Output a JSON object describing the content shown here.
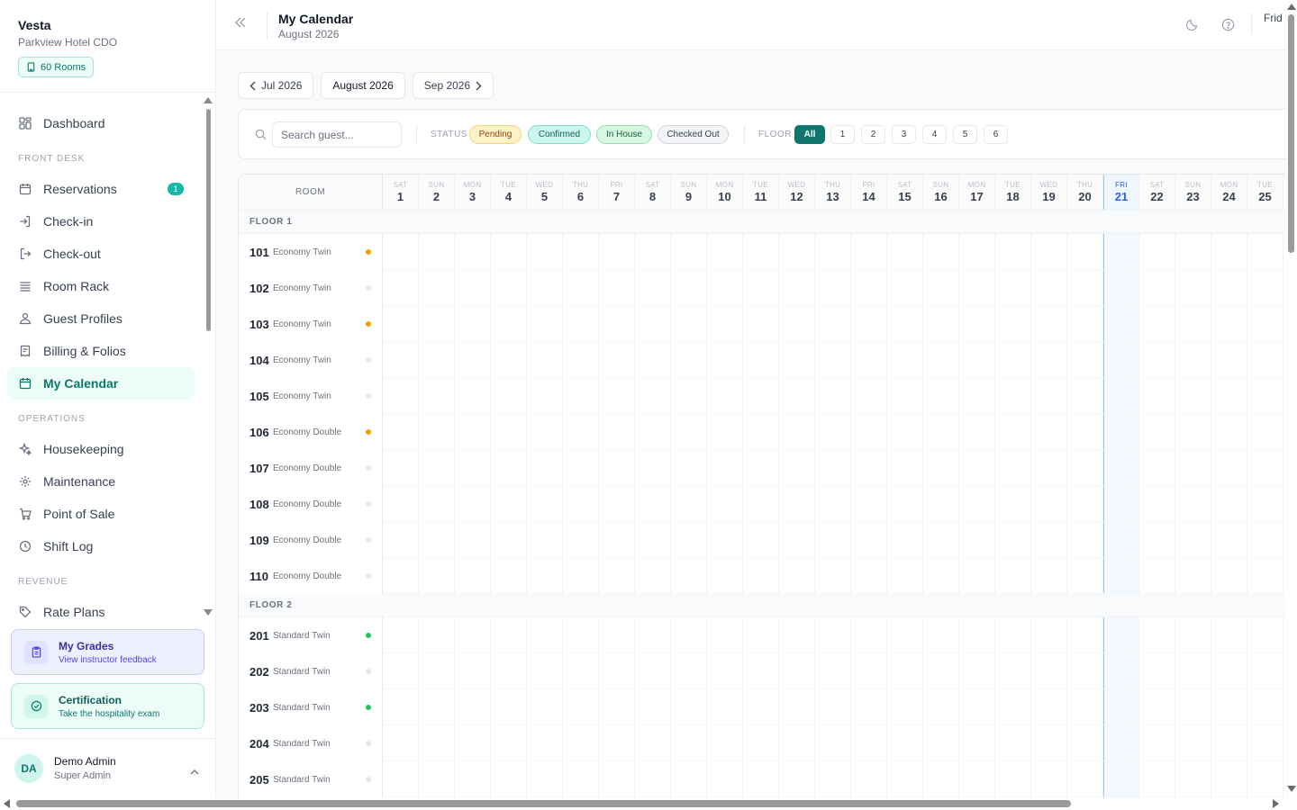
{
  "brand": {
    "name": "Vesta",
    "property": "Parkview Hotel CDO",
    "rooms_badge": "60 Rooms"
  },
  "nav": {
    "dashboard": "Dashboard",
    "sections": {
      "front_desk": "FRONT DESK",
      "operations": "OPERATIONS",
      "revenue": "REVENUE"
    },
    "front_desk": [
      {
        "label": "Reservations",
        "icon": "calendar-icon",
        "badge": "1"
      },
      {
        "label": "Check-in",
        "icon": "login-icon"
      },
      {
        "label": "Check-out",
        "icon": "logout-icon"
      },
      {
        "label": "Room Rack",
        "icon": "list-icon"
      },
      {
        "label": "Guest Profiles",
        "icon": "users-icon"
      },
      {
        "label": "Billing & Folios",
        "icon": "receipt-icon"
      },
      {
        "label": "My Calendar",
        "icon": "calendar-icon",
        "active": true
      }
    ],
    "operations": [
      {
        "label": "Housekeeping",
        "icon": "sparkle-icon"
      },
      {
        "label": "Maintenance",
        "icon": "gear-icon"
      },
      {
        "label": "Point of Sale",
        "icon": "cart-icon"
      },
      {
        "label": "Shift Log",
        "icon": "clock-icon"
      }
    ],
    "revenue": [
      {
        "label": "Rate Plans",
        "icon": "tag-icon"
      }
    ]
  },
  "promos": {
    "grades": {
      "title": "My Grades",
      "subtitle": "View instructor feedback"
    },
    "certification": {
      "title": "Certification",
      "subtitle": "Take the hospitality exam"
    }
  },
  "user": {
    "initials": "DA",
    "name": "Demo Admin",
    "role": "Super Admin"
  },
  "header": {
    "title": "My Calendar",
    "subtitle": "August 2026",
    "day_label": "Frid"
  },
  "month_nav": {
    "prev": "Jul 2026",
    "current": "August 2026",
    "next": "Sep 2026"
  },
  "filters": {
    "search_placeholder": "Search guest...",
    "status_label": "STATUS",
    "statuses": [
      "Pending",
      "Confirmed",
      "In House",
      "Checked Out"
    ],
    "floor_label": "FLOOR",
    "floors": [
      "All",
      "1",
      "2",
      "3",
      "4",
      "5",
      "6"
    ]
  },
  "calendar": {
    "room_header": "ROOM",
    "today": 21,
    "days": [
      {
        "dow": "SAT",
        "day": "1"
      },
      {
        "dow": "SUN",
        "day": "2"
      },
      {
        "dow": "MON",
        "day": "3"
      },
      {
        "dow": "TUE",
        "day": "4"
      },
      {
        "dow": "WED",
        "day": "5"
      },
      {
        "dow": "THU",
        "day": "6"
      },
      {
        "dow": "FRI",
        "day": "7"
      },
      {
        "dow": "SAT",
        "day": "8"
      },
      {
        "dow": "SUN",
        "day": "9"
      },
      {
        "dow": "MON",
        "day": "10"
      },
      {
        "dow": "TUE",
        "day": "11"
      },
      {
        "dow": "WED",
        "day": "12"
      },
      {
        "dow": "THU",
        "day": "13"
      },
      {
        "dow": "FRI",
        "day": "14"
      },
      {
        "dow": "SAT",
        "day": "15"
      },
      {
        "dow": "SUN",
        "day": "16"
      },
      {
        "dow": "MON",
        "day": "17"
      },
      {
        "dow": "TUE",
        "day": "18"
      },
      {
        "dow": "WED",
        "day": "19"
      },
      {
        "dow": "THU",
        "day": "20"
      },
      {
        "dow": "FRI",
        "day": "21"
      },
      {
        "dow": "SAT",
        "day": "22"
      },
      {
        "dow": "SUN",
        "day": "23"
      },
      {
        "dow": "MON",
        "day": "24"
      },
      {
        "dow": "TUE",
        "day": "25"
      }
    ],
    "floors": [
      {
        "label": "FLOOR 1",
        "rooms": [
          {
            "number": "101",
            "type": "Economy Twin",
            "status_color": "#f59e0b"
          },
          {
            "number": "102",
            "type": "Economy Twin",
            "status_color": "#e5e7eb"
          },
          {
            "number": "103",
            "type": "Economy Twin",
            "status_color": "#f59e0b"
          },
          {
            "number": "104",
            "type": "Economy Twin",
            "status_color": "#e5e7eb"
          },
          {
            "number": "105",
            "type": "Economy Twin",
            "status_color": "#e5e7eb"
          },
          {
            "number": "106",
            "type": "Economy Double",
            "status_color": "#f59e0b"
          },
          {
            "number": "107",
            "type": "Economy Double",
            "status_color": "#e5e7eb"
          },
          {
            "number": "108",
            "type": "Economy Double",
            "status_color": "#e5e7eb"
          },
          {
            "number": "109",
            "type": "Economy Double",
            "status_color": "#e5e7eb"
          },
          {
            "number": "110",
            "type": "Economy Double",
            "status_color": "#e5e7eb"
          }
        ]
      },
      {
        "label": "FLOOR 2",
        "rooms": [
          {
            "number": "201",
            "type": "Standard Twin",
            "status_color": "#22c55e"
          },
          {
            "number": "202",
            "type": "Standard Twin",
            "status_color": "#e5e7eb"
          },
          {
            "number": "203",
            "type": "Standard Twin",
            "status_color": "#22c55e"
          },
          {
            "number": "204",
            "type": "Standard Twin",
            "status_color": "#e5e7eb"
          },
          {
            "number": "205",
            "type": "Standard Twin",
            "status_color": "#e5e7eb"
          }
        ]
      }
    ]
  },
  "colors": {
    "accent": "#0f766e",
    "today": "#2563eb"
  }
}
